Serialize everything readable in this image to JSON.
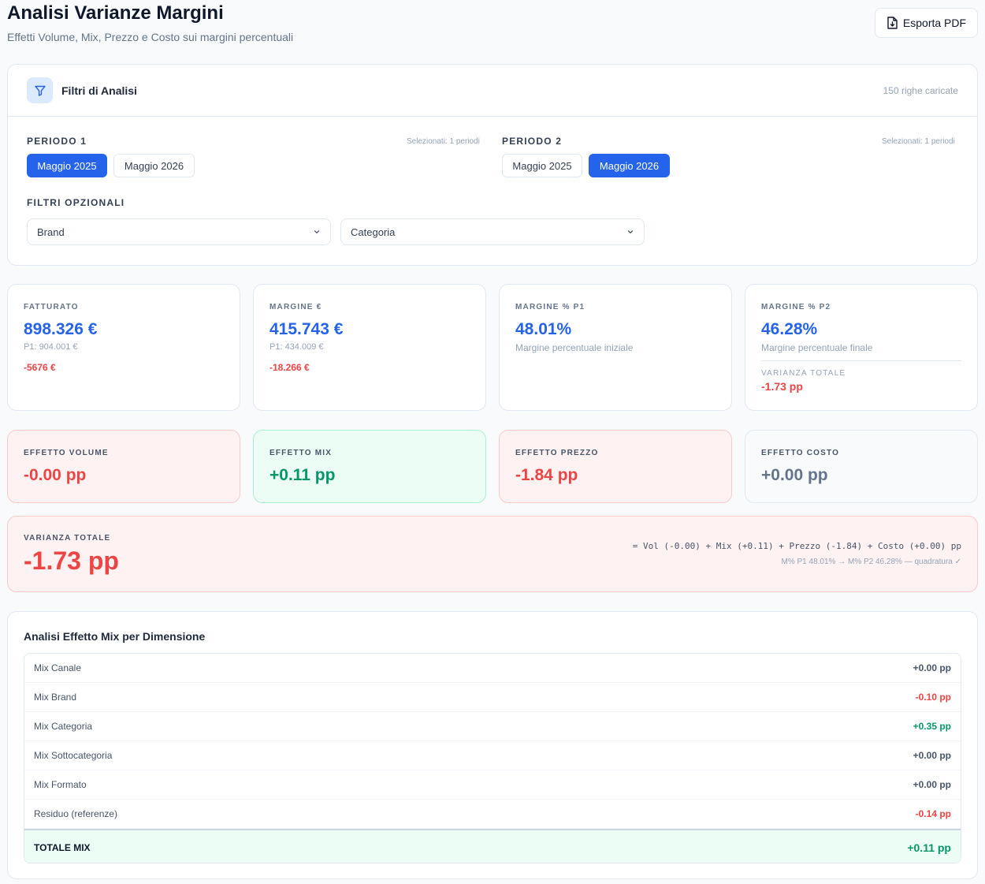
{
  "header": {
    "title": "Analisi Varianze Margini",
    "subtitle": "Effetti Volume, Mix, Prezzo e Costo sui margini percentuali",
    "export_label": "Esporta PDF"
  },
  "filters": {
    "title": "Filtri di Analisi",
    "rows_loaded": "150 righe caricate",
    "period1": {
      "label": "PERIODO 1",
      "selected_note": "Selezionati: 1 periodi",
      "options": [
        {
          "label": "Maggio 2025",
          "selected": true
        },
        {
          "label": "Maggio 2026",
          "selected": false
        }
      ]
    },
    "period2": {
      "label": "PERIODO 2",
      "selected_note": "Selezionati: 1 periodi",
      "options": [
        {
          "label": "Maggio 2025",
          "selected": false
        },
        {
          "label": "Maggio 2026",
          "selected": true
        }
      ]
    },
    "optional": {
      "label": "FILTRI OPZIONALI",
      "brand": "Brand",
      "categoria": "Categoria"
    }
  },
  "kpis": {
    "fatturato": {
      "label": "FATTURATO",
      "value": "898.326 €",
      "p1": "P1: 904.001 €",
      "delta": "-5676 €"
    },
    "margine": {
      "label": "MARGINE €",
      "value": "415.743 €",
      "p1": "P1: 434.009 €",
      "delta": "-18.266 €"
    },
    "margine_p1": {
      "label": "MARGINE % P1",
      "value": "48.01%",
      "desc": "Margine percentuale iniziale"
    },
    "margine_p2": {
      "label": "MARGINE % P2",
      "value": "46.28%",
      "desc": "Margine percentuale finale",
      "var_label": "VARIANZA TOTALE",
      "var_value": "-1.73 pp"
    }
  },
  "effects": {
    "volume": {
      "label": "EFFETTO VOLUME",
      "value": "-0.00 pp"
    },
    "mix": {
      "label": "EFFETTO MIX",
      "value": "+0.11 pp"
    },
    "prezzo": {
      "label": "EFFETTO PREZZO",
      "value": "-1.84 pp"
    },
    "costo": {
      "label": "EFFETTO COSTO",
      "value": "+0.00 pp"
    }
  },
  "total_variance": {
    "label": "VARIANZA TOTALE",
    "value": "-1.73 pp",
    "formula": "= Vol (-0.00) + Mix (+0.11) + Prezzo (-1.84) + Costo (+0.00) pp",
    "check": "M% P1 48.01% → M% P2 46.28% — quadratura ✓"
  },
  "mix_analysis": {
    "title": "Analisi Effetto Mix per Dimensione",
    "rows": [
      {
        "label": "Mix Canale",
        "value": "+0.00 pp",
        "tone": "neu"
      },
      {
        "label": "Mix Brand",
        "value": "-0.10 pp",
        "tone": "neg"
      },
      {
        "label": "Mix Categoria",
        "value": "+0.35 pp",
        "tone": "pos"
      },
      {
        "label": "Mix Sottocategoria",
        "value": "+0.00 pp",
        "tone": "neu"
      },
      {
        "label": "Mix Formato",
        "value": "+0.00 pp",
        "tone": "neu"
      },
      {
        "label": "Residuo (referenze)",
        "value": "-0.14 pp",
        "tone": "neg"
      }
    ],
    "total_label": "TOTALE MIX",
    "total_value": "+0.11 pp"
  },
  "colors": {
    "accent": "#2563eb",
    "negative": "#ef4444",
    "positive": "#059669",
    "neutral": "#64748b"
  }
}
